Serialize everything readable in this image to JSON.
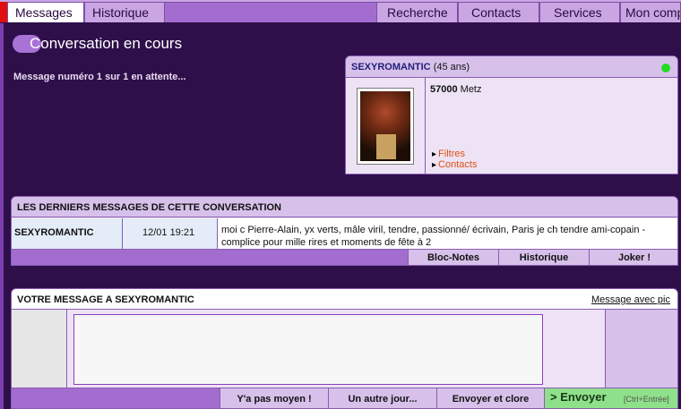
{
  "tabs": {
    "left": [
      "Messages",
      "Historique"
    ],
    "right": [
      "Recherche",
      "Contacts",
      "Services",
      "Mon compte"
    ]
  },
  "page": {
    "title": "Conversation en cours",
    "pending_text": "Message numéro 1 sur 1 en attente..."
  },
  "profile": {
    "name": "SEXYROMANTIC",
    "age": "(45 ans)",
    "postal_code": "57000",
    "city": "Metz",
    "links": [
      "Filtres",
      "Contacts"
    ],
    "status_color": "#22dd22"
  },
  "last_messages": {
    "header": "LES DERNIERS MESSAGES DE CETTE CONVERSATION",
    "rows": [
      {
        "sender": "SEXYROMANTIC",
        "date": "12/01 19:21",
        "text": "moi c Pierre-Alain, yx verts, mâle viril, tendre, passionné/ écrivain, Paris je ch tendre ami-copain -complice pour mille rires et moments de fête à 2"
      }
    ],
    "buttons": [
      "Bloc-Notes",
      "Historique",
      "Joker !"
    ]
  },
  "compose": {
    "header": "VOTRE MESSAGE A SEXYROMANTIC",
    "pic_link": "Message avec pic",
    "message_value": "",
    "quick_buttons": [
      "Y'a pas moyen !",
      "Un autre jour...",
      "Envoyer et clore"
    ],
    "send_label": "> Envoyer",
    "send_hint": "[Ctrl+Entrée]"
  },
  "colors": {
    "background": "#2e0f4a",
    "accent": "#a36dd0",
    "alert": "#e01010",
    "send": "#8fe08a"
  }
}
